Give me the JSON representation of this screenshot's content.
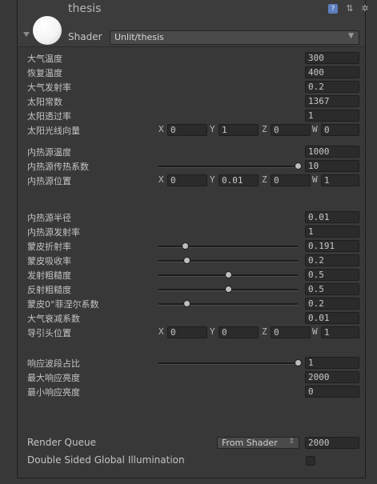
{
  "header": {
    "title": "thesis",
    "shader_label": "Shader",
    "shader_value": "Unlit/thesis",
    "icons": [
      "help-book-icon",
      "preset-icon",
      "gear-icon"
    ]
  },
  "axes": {
    "x": "X",
    "y": "Y",
    "z": "Z",
    "w": "W"
  },
  "props": {
    "atm_temp": {
      "label": "大气温度",
      "value": "300"
    },
    "restore_temp": {
      "label": "恢复温度",
      "value": "400"
    },
    "atm_emissivity": {
      "label": "大气发射率",
      "value": "0.2"
    },
    "solar_const": {
      "label": "太阳常数",
      "value": "1367"
    },
    "sun_transmit": {
      "label": "太阳透过率",
      "value": "1"
    },
    "sun_dir": {
      "label": "太阳光线向量",
      "x": "0",
      "y": "1",
      "z": "0",
      "w": "0"
    },
    "heat_temp": {
      "label": "内热源温度",
      "value": "1000"
    },
    "heat_coeff": {
      "label": "内热源传热系数",
      "value": "10",
      "slider": 1.0
    },
    "heat_pos": {
      "label": "内热源位置",
      "x": "0",
      "y": "0.01",
      "z": "0",
      "w": "1"
    },
    "heat_radius": {
      "label": "内热源半径",
      "value": "0.01"
    },
    "heat_emit": {
      "label": "内热源发射率",
      "value": "1"
    },
    "skin_refract": {
      "label": "蒙皮折射率",
      "value": "0.191",
      "slider": 0.191
    },
    "skin_absorb": {
      "label": "蒙皮吸收率",
      "value": "0.2",
      "slider": 0.2
    },
    "emit_rough": {
      "label": "发射粗糙度",
      "value": "0.5",
      "slider": 0.5
    },
    "reflect_rough": {
      "label": "反射粗糙度",
      "value": "0.5",
      "slider": 0.5
    },
    "skin_fresnel": {
      "label": "蒙皮0°菲涅尔系数",
      "value": "0.2",
      "slider": 0.2
    },
    "atm_attenuation": {
      "label": "大气衰减系数",
      "value": "0.01"
    },
    "seeker_pos": {
      "label": "导引头位置",
      "x": "0",
      "y": "0",
      "z": "0",
      "w": "1"
    },
    "band_ratio": {
      "label": "响应波段占比",
      "value": "1",
      "slider": 1.0
    },
    "max_bright": {
      "label": "最大响应亮度",
      "value": "2000"
    },
    "min_bright": {
      "label": "最小响应亮度",
      "value": "0"
    }
  },
  "render_queue": {
    "label": "Render Queue",
    "dropdown": "From Shader",
    "value": "2000"
  },
  "double_sided_gi": {
    "label": "Double Sided Global Illumination",
    "checked": false
  }
}
